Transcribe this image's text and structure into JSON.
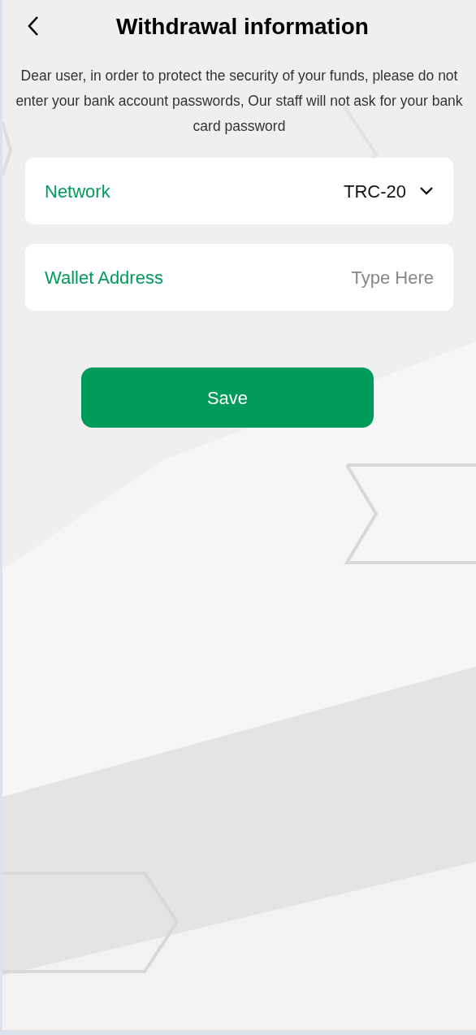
{
  "header": {
    "title": "Withdrawal information"
  },
  "notice": "Dear user, in order to protect the security of your funds, please do not enter your bank account passwords, Our staff will not ask for your bank card password",
  "fields": [
    {
      "kind": "select",
      "label": "Network",
      "value": "TRC-20"
    },
    {
      "kind": "input",
      "label": "Wallet Address",
      "placeholder": "Type Here"
    }
  ],
  "save_button": "Save"
}
